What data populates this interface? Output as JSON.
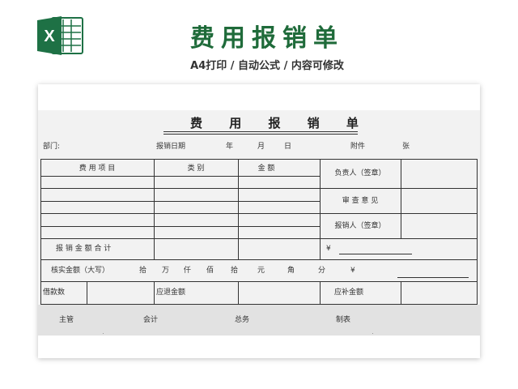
{
  "banner": {
    "title": "费用报销单",
    "subtitle": "A4打印 / 自动公式 / 内容可修改",
    "logo_letter": "X",
    "accent_color": "#1f6b3a",
    "logo_color": "#1e7145"
  },
  "form": {
    "title": "费 用 报 销 单",
    "dept_label": "部门:",
    "date_label": "报销日期",
    "year": "年",
    "month": "月",
    "day": "日",
    "attach_label": "附件",
    "sheets_unit": "张",
    "headers": {
      "item": "费  用  项  目",
      "category": "类  别",
      "amount": "金  额"
    },
    "side_labels": {
      "responsible": "负责人（签章）",
      "review": "审 查 意 见",
      "claimant": "报销人（签章）"
    },
    "total_label": "报 销 金 额 合 计",
    "yen": "¥",
    "verified_label": "核实金额（大写）",
    "units": [
      "拾",
      "万",
      "仟",
      "佰",
      "拾",
      "元",
      "角",
      "分"
    ],
    "loan_label": "借款数",
    "refund_label": "应退金额",
    "supplement_label": "应补金额",
    "signatures": [
      "主管",
      "会计",
      "总务",
      "制表"
    ]
  }
}
